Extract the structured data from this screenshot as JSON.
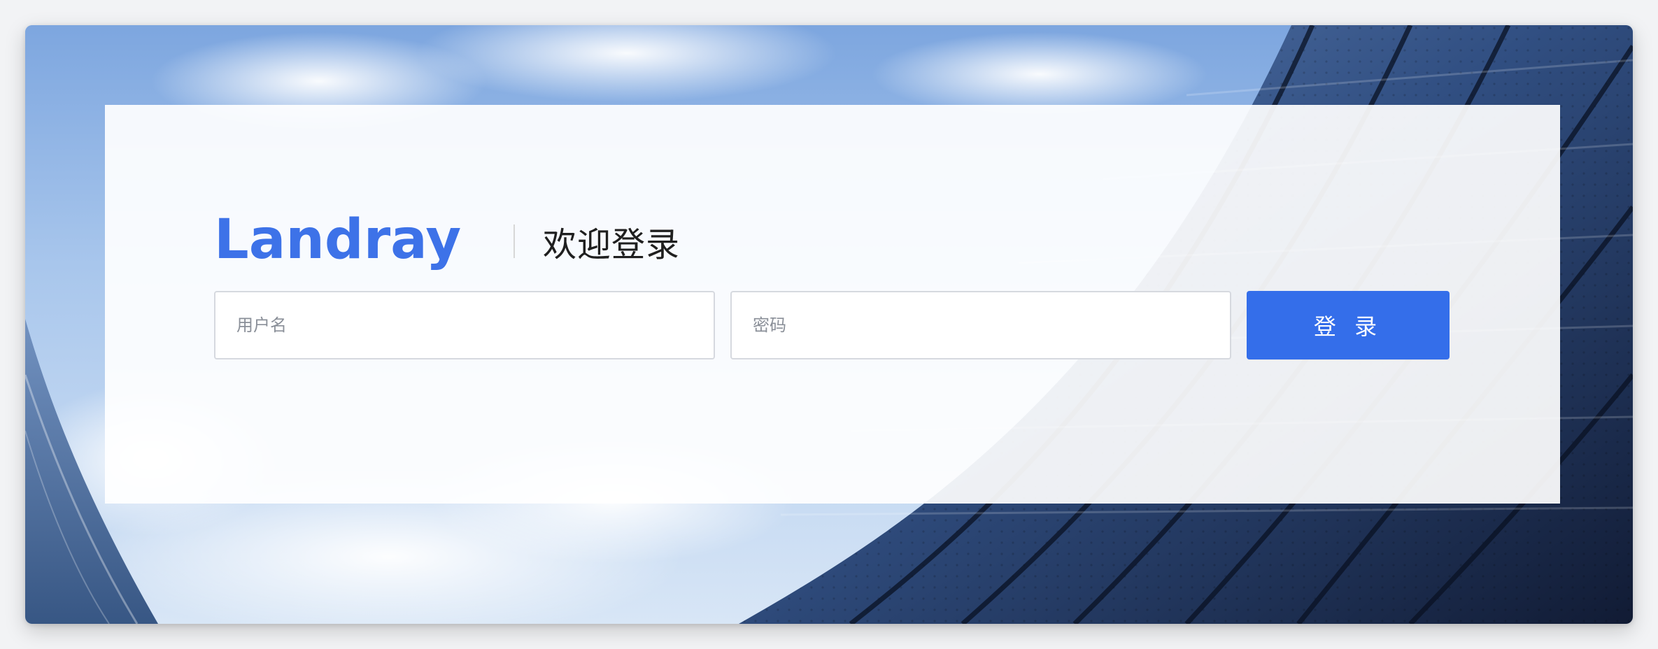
{
  "brand": {
    "logo_text": "Landray",
    "welcome_text": "欢迎登录"
  },
  "form": {
    "username_placeholder": "用户名",
    "password_placeholder": "密码",
    "submit_label": "登 录"
  },
  "colors": {
    "primary": "#346eea",
    "logo_blue": "#3d72e8",
    "card_bg": "#ffffff",
    "input_border": "#d6d9df"
  },
  "icons": [
    "logo"
  ]
}
